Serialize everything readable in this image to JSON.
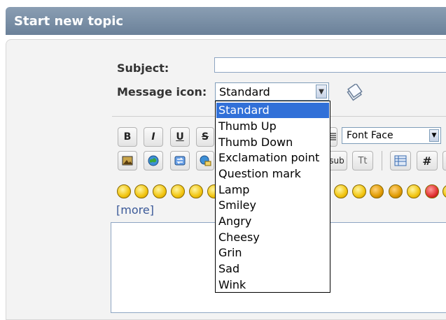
{
  "header": {
    "title": "Start new topic"
  },
  "form": {
    "subject_label": "Subject:",
    "subject_value": "",
    "icon_label": "Message icon:",
    "icon_selected": "Standard"
  },
  "toolbar": {
    "bold": "B",
    "italic": "I",
    "underline": "U",
    "strike": "S",
    "sub": "sub",
    "tt": "Tt",
    "hash": "#",
    "font_face": "Font Face"
  },
  "smileys_more": "[more]",
  "icon_options": [
    "Standard",
    "Thumb Up",
    "Thumb Down",
    "Exclamation point",
    "Question mark",
    "Lamp",
    "Smiley",
    "Angry",
    "Cheesy",
    "Grin",
    "Sad",
    "Wink"
  ]
}
